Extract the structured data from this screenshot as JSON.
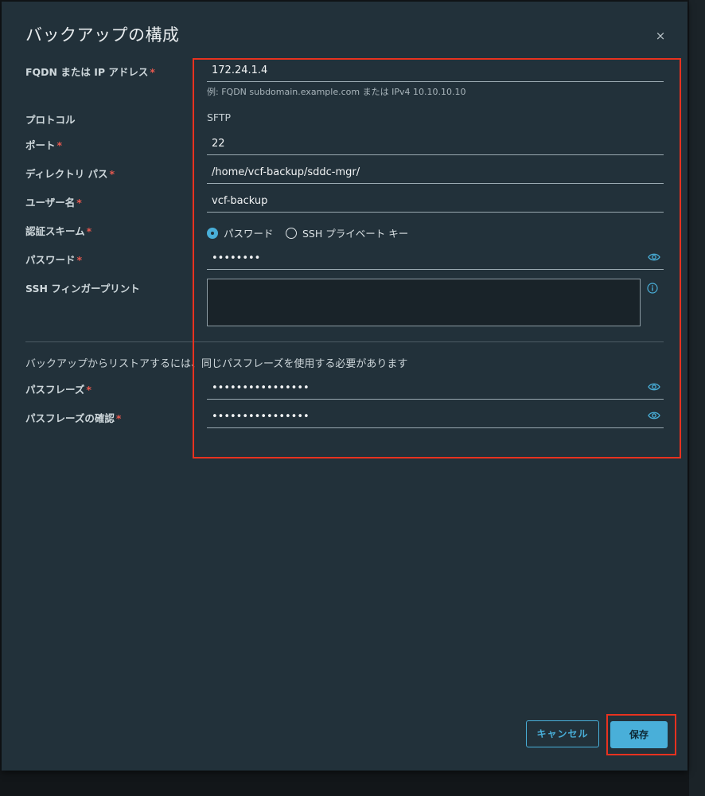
{
  "dialog": {
    "title": "バックアップの構成",
    "close_label": "×"
  },
  "form": {
    "fqdn": {
      "label": "FQDN または IP アドレス",
      "required": "*",
      "value": "172.24.1.4",
      "hint": "例: FQDN subdomain.example.com または IPv4 10.10.10.10"
    },
    "protocol": {
      "label": "プロトコル",
      "value": "SFTP"
    },
    "port": {
      "label": "ポート",
      "required": "*",
      "value": "22"
    },
    "directory": {
      "label": "ディレクトリ パス",
      "required": "*",
      "value": "/home/vcf-backup/sddc-mgr/"
    },
    "username": {
      "label": "ユーザー名",
      "required": "*",
      "value": "vcf-backup"
    },
    "auth_scheme": {
      "label": "認証スキーム",
      "required": "*",
      "options": [
        "パスワード",
        "SSH プライベート キー"
      ],
      "selected": "パスワード"
    },
    "password": {
      "label": "パスワード",
      "required": "*",
      "value": "••••••••"
    },
    "ssh_fingerprint": {
      "label": "SSH フィンガープリント",
      "value": ""
    },
    "passphrase_note": "バックアップからリストアするには、同じパスフレーズを使用する必要があります",
    "passphrase": {
      "label": "パスフレーズ",
      "required": "*",
      "value": "••••••••••••••••"
    },
    "passphrase_confirm": {
      "label": "パスフレーズの確認",
      "required": "*",
      "value": "••••••••••••••••"
    }
  },
  "footer": {
    "cancel_label": "キャンセル",
    "save_label": "保存"
  },
  "colors": {
    "modal_bg": "#22313a",
    "accent": "#49afd9",
    "required": "#e8594f",
    "annotation": "#e8321f"
  }
}
